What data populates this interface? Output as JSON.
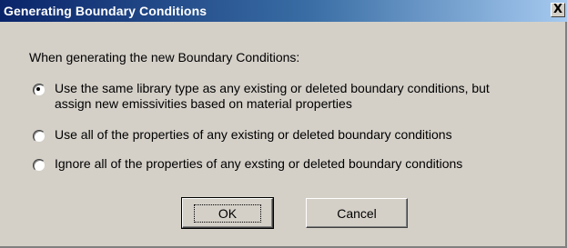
{
  "dialog": {
    "title": "Generating Boundary Conditions",
    "close_glyph": "X",
    "intro": "When generating the new Boundary Conditions:",
    "options": [
      {
        "line1": "Use the same library type as any existing or deleted boundary conditions, but",
        "line2": "assign new emissivities based on material properties",
        "selected": true
      },
      {
        "line1": "Use all of the properties of any existing or deleted boundary conditions",
        "selected": false
      },
      {
        "line1": "Ignore all of the properties of any exsting or deleted boundary conditions",
        "selected": false
      }
    ],
    "ok_label": "OK",
    "cancel_label": "Cancel"
  },
  "colors": {
    "titlebar_start": "#0a246a",
    "titlebar_end": "#a6caf0",
    "face": "#d4d0c8"
  }
}
